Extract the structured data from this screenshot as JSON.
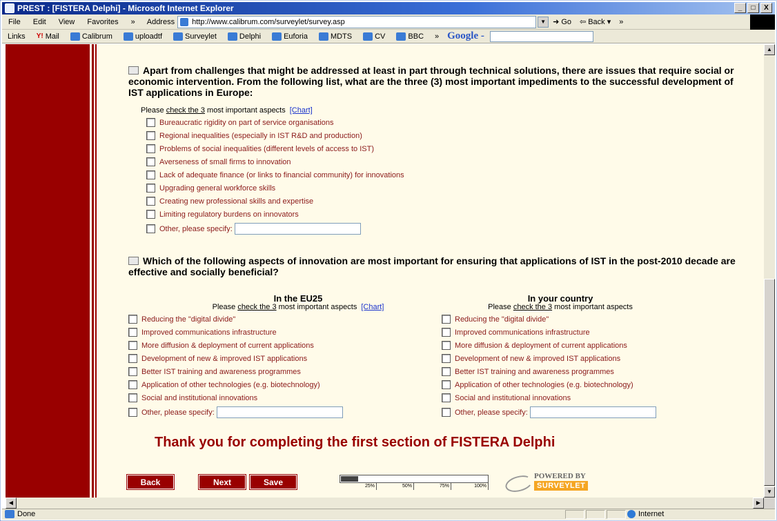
{
  "window": {
    "title": "PREST : [FISTERA Delphi] - Microsoft Internet Explorer",
    "buttons": [
      "_",
      "□",
      "X"
    ]
  },
  "menu": {
    "items": [
      "File",
      "Edit",
      "View",
      "Favorites"
    ],
    "chevron": "»",
    "address_label": "Address",
    "address_value": "http://www.calibrum.com/surveylet/survey.asp",
    "go_label": "Go",
    "back_label": "Back"
  },
  "links": {
    "label": "Links",
    "items": [
      "Mail",
      "Calibrum",
      "uploadtf",
      "Surveylet",
      "Delphi",
      "Euforia",
      "MDTS",
      "CV",
      "BBC"
    ],
    "chevron": "»",
    "google": "Google -"
  },
  "q1": {
    "text": "Apart from challenges that might be addressed at least in part through technical solutions, there are issues that require social or economic intervention. From the following list, what are the three (3) most important impediments to the successful development of IST applications in Europe:",
    "hint_pre": "Please ",
    "hint_link": "check the 3",
    "hint_post": " most important aspects",
    "chart_link": "[Chart]",
    "options": [
      "Bureaucratic rigidity on part of service organisations",
      "Regional inequalities (especially in IST R&D and production)",
      "Problems of social inequalities (different levels of access to IST)",
      "Averseness of small firms to innovation",
      "Lack of adequate finance (or links to financial community) for innovations",
      "Upgrading general workforce skills",
      "Creating new professional skills and expertise",
      "Limiting regulatory burdens on innovators",
      "Other, please specify:"
    ]
  },
  "q2": {
    "text": "Which of the following aspects of innovation are most important for ensuring that applications of IST in the post-2010 decade are effective and socially beneficial?",
    "col1_title": "In the EU25",
    "col2_title": "In your country",
    "hint_pre": "Please ",
    "hint_link": "check the 3",
    "hint_post": " most important aspects",
    "chart_link": "[Chart]",
    "options": [
      "Reducing the \"digital divide\"",
      "Improved communications infrastructure",
      "More diffusion & deployment of current applications",
      "Development of new & improved IST applications",
      "Better IST training and awareness programmes",
      "Application of other technologies (e.g. biotechnology)",
      "Social and institutional innovations",
      "Other, please specify:"
    ]
  },
  "thanks": "Thank you for completing the first section of FISTERA Delphi",
  "buttons": {
    "back": "Back",
    "next": "Next",
    "save": "Save"
  },
  "progress": {
    "fraction": 0.12,
    "ticks": [
      "25%",
      "50%",
      "75%",
      "100%"
    ]
  },
  "powered": {
    "line1": "POWERED BY",
    "logo": "SURVEYLET"
  },
  "status": {
    "left": "Done",
    "zone": "Internet"
  }
}
